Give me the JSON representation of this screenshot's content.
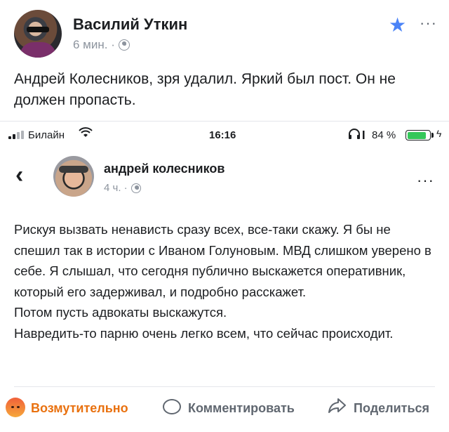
{
  "outer_post": {
    "author": "Василий Уткин",
    "time": "6 мин. ·",
    "text": "Андрей Колесников, зря удалил. Яркий был пост. Он не должен пропасть.",
    "more": "···"
  },
  "status_bar": {
    "carrier": "Билайн",
    "time": "16:16",
    "battery": "84 %",
    "battery_level": 0.84
  },
  "inner_post": {
    "back": "‹",
    "author": "андрей колесников",
    "time": "4 ч. ·",
    "more": "···",
    "text": "Рискуя вызвать ненависть сразу всех, все-таки скажу. Я бы не спешил так в истории с Иваном Голуновым. МВД слишком уверено в себе. Я слышал, что сегодня публично выскажется оперативник, который его задерживал, и подробно расскажет.\nПотом пусть адвокаты выскажутся.\nНавредить-то парню очень легко всем, что сейчас происходит."
  },
  "actions": {
    "reaction": "Возмутительно",
    "comment": "Комментировать",
    "share": "Поделиться"
  },
  "colors": {
    "reaction": "#e9710f",
    "star": "#4a83f7",
    "battery": "#34c759"
  },
  "icons": [
    "star-icon",
    "globe-icon",
    "signal-icon",
    "wifi-icon",
    "headphones-icon",
    "battery-icon",
    "bolt-icon",
    "back-icon",
    "angry-face-icon",
    "comment-icon",
    "share-icon"
  ]
}
